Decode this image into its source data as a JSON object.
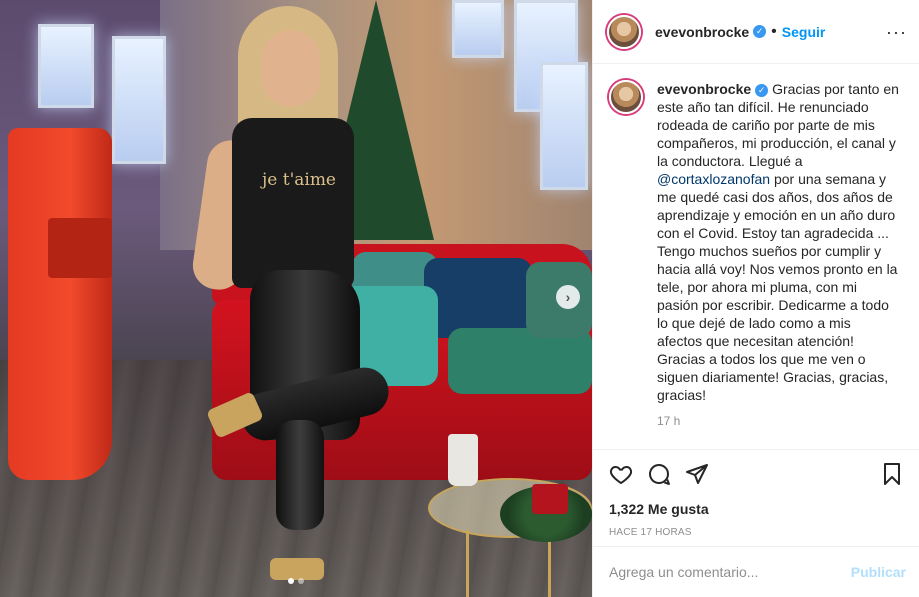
{
  "post": {
    "username": "evevonbrocke",
    "verified_mark": "✓",
    "separator": "•",
    "follow_label": "Seguir",
    "more_label": "···",
    "caption_parts": [
      "Gracias por tanto en este año tan difícil. He renunciado rodeada de cariño por parte de mis compañeros, mi producción, el canal y la conductora. Llegué a ",
      "@cortaxlozanofan",
      " por una semana y me quedé casi dos años, dos años de aprendizaje y emoción en un año duro con el Covid. Estoy tan agradecida ... Tengo muchos sueños por cumplir y hacia allá voy! Nos vemos pronto en la tele, por ahora mi pluma, con mi pasión por escribir. Dedicarme a todo lo que dejé de lado como a mis afectos que necesitan atención! Gracias a todos los que me ven o siguen diariamente! Gracias, gracias, gracias!"
    ],
    "caption_age": "17 h",
    "likes": "1,322 Me gusta",
    "date": "HACE 17 HORAS",
    "shirt_text": "je t'aime"
  },
  "carousel": {
    "next_label": "›",
    "total_slides": 2,
    "active_slide": 1
  },
  "comment": {
    "placeholder": "Agrega un comentario...",
    "publish_label": "Publicar"
  },
  "icons": {
    "like": "heart-icon",
    "comment": "comment-bubble-icon",
    "share": "paper-plane-icon",
    "save": "bookmark-icon",
    "next": "chevron-right-icon"
  },
  "colors": {
    "link": "#0095f6",
    "mention": "#00376b",
    "verified": "#3897f0",
    "publish_disabled": "#b2dffc",
    "muted": "#8e8e8e"
  }
}
